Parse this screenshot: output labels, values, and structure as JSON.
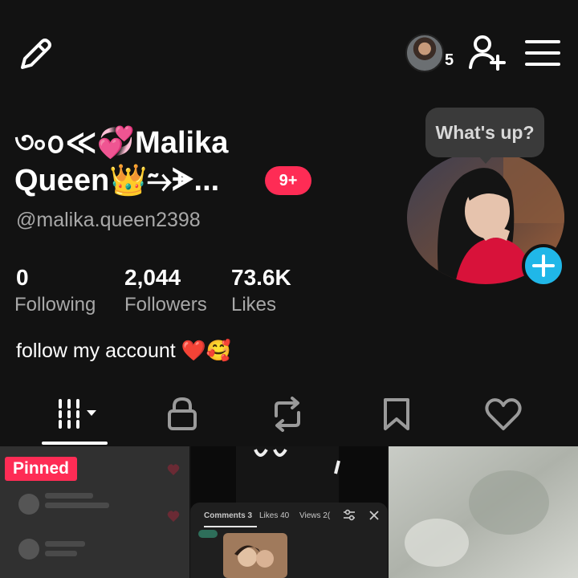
{
  "header": {
    "edit_icon": "pencil-icon",
    "profile_view_count": "5",
    "add_friend_icon": "add-user-icon",
    "menu_icon": "hamburger-menu-icon"
  },
  "profile": {
    "name_line1": "৩৹ᩅ≪💞Malika",
    "name_line2": "Queen👑⥲ᗘ...",
    "notification_badge": "9+",
    "username": "@malika.queen2398",
    "status_bubble": "What's up?",
    "bio": "follow my account ❤️🥰"
  },
  "stats": [
    {
      "value": "0",
      "label": "Following"
    },
    {
      "value": "2,044",
      "label": "Followers"
    },
    {
      "value": "73.6K",
      "label": "Likes"
    }
  ],
  "tabs": [
    {
      "name": "videos",
      "icon": "grid-icon"
    },
    {
      "name": "private",
      "icon": "lock-icon"
    },
    {
      "name": "reposts",
      "icon": "repost-icon"
    },
    {
      "name": "favorites",
      "icon": "bookmark-icon"
    },
    {
      "name": "liked",
      "icon": "heart-icon"
    }
  ],
  "grid": {
    "pinned_label": "Pinned",
    "comments_panel": {
      "comments": "Comments 3",
      "likes": "Likes 40",
      "views": "Views 2("
    }
  },
  "colors": {
    "background": "#121212",
    "accent": "#fe2c55",
    "add_button": "#20b7e8",
    "muted_text": "#a8a8a8"
  }
}
